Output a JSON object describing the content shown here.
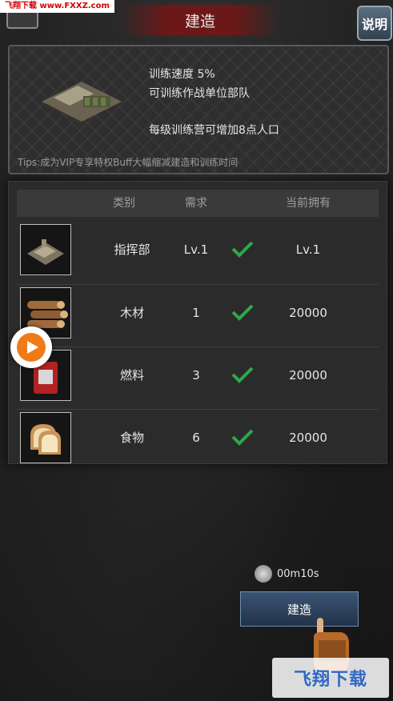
{
  "watermark_top": "飞翔下载 www.FXXZ.com",
  "title": "建造",
  "help_label": "说明",
  "info": {
    "line1": "训练速度    5%",
    "line2": "可训练作战单位部队",
    "line3": "每级训练营可增加8点人口",
    "tips": "Tips:成为VIP专享特权Buff大幅缩减建造和训练时间"
  },
  "table": {
    "headers": [
      "类别",
      "需求",
      "当前拥有"
    ],
    "rows": [
      {
        "name": "指挥部",
        "required": "Lv.1",
        "owned": "Lv.1",
        "icon": "command-hq-icon"
      },
      {
        "name": "木材",
        "required": "1",
        "owned": "20000",
        "icon": "wood-logs-icon"
      },
      {
        "name": "燃料",
        "required": "3",
        "owned": "20000",
        "icon": "fuel-can-icon"
      },
      {
        "name": "食物",
        "required": "6",
        "owned": "20000",
        "icon": "bread-icon"
      }
    ]
  },
  "timer": "00m10s",
  "build_label": "建造",
  "watermark_bottom": "飞翔下载",
  "colors": {
    "check": "#2fa84a",
    "title_red": "#781414",
    "button_blue": "#3b5472"
  }
}
